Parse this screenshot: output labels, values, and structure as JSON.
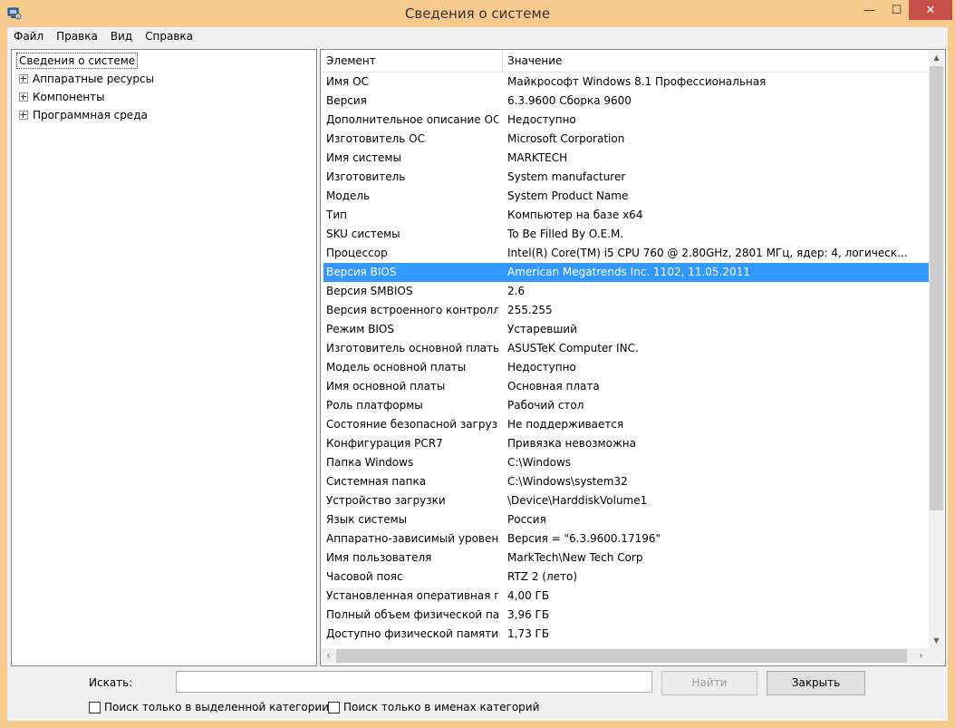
{
  "window": {
    "title": "Сведения о системе",
    "minimize": "—",
    "maximize": "☐",
    "close": "✕"
  },
  "menu": [
    "Файл",
    "Правка",
    "Вид",
    "Справка"
  ],
  "tree": {
    "root": "Сведения о системе",
    "children": [
      "Аппаратные ресурсы",
      "Компоненты",
      "Программная среда"
    ]
  },
  "list": {
    "columns": [
      "Элемент",
      "Значение"
    ],
    "selected_index": 10,
    "rows": [
      {
        "item": "Имя ОС",
        "value": "Майкрософт Windows 8.1 Профессиональная"
      },
      {
        "item": "Версия",
        "value": "6.3.9600 Сборка 9600"
      },
      {
        "item": "Дополнительное описание ОС",
        "value": "Недоступно"
      },
      {
        "item": "Изготовитель ОС",
        "value": "Microsoft Corporation"
      },
      {
        "item": "Имя системы",
        "value": "MARKTECH"
      },
      {
        "item": "Изготовитель",
        "value": "System manufacturer"
      },
      {
        "item": "Модель",
        "value": "System Product Name"
      },
      {
        "item": "Тип",
        "value": "Компьютер на базе x64"
      },
      {
        "item": "SKU системы",
        "value": "To Be Filled By O.E.M."
      },
      {
        "item": "Процессор",
        "value": "Intel(R) Core(TM) i5 CPU        760  @ 2.80GHz, 2801 МГц, ядер: 4, логическ..."
      },
      {
        "item": "Версия BIOS",
        "value": "American Megatrends Inc. 1102, 11.05.2011"
      },
      {
        "item": "Версия SMBIOS",
        "value": "2.6"
      },
      {
        "item": "Версия встроенного контролл...",
        "value": "255.255"
      },
      {
        "item": "Режим BIOS",
        "value": "Устаревший"
      },
      {
        "item": "Изготовитель основной платы",
        "value": "ASUSTeK Computer INC."
      },
      {
        "item": "Модель основной платы",
        "value": "Недоступно"
      },
      {
        "item": "Имя основной платы",
        "value": "Основная плата"
      },
      {
        "item": "Роль платформы",
        "value": "Рабочий стол"
      },
      {
        "item": "Состояние безопасной загруз...",
        "value": "Не поддерживается"
      },
      {
        "item": "Конфигурация PCR7",
        "value": "Привязка невозможна"
      },
      {
        "item": "Папка Windows",
        "value": "C:\\Windows"
      },
      {
        "item": "Системная папка",
        "value": "C:\\Windows\\system32"
      },
      {
        "item": "Устройство загрузки",
        "value": "\\Device\\HarddiskVolume1"
      },
      {
        "item": "Язык системы",
        "value": "Россия"
      },
      {
        "item": "Аппаратно-зависимый уровен...",
        "value": "Версия = \"6.3.9600.17196\""
      },
      {
        "item": "Имя пользователя",
        "value": "MarkTech\\New Tech Corp"
      },
      {
        "item": "Часовой пояс",
        "value": "RTZ 2 (лето)"
      },
      {
        "item": "Установленная оперативная п...",
        "value": "4,00 ГБ"
      },
      {
        "item": "Полный объем физической па...",
        "value": "3,96 ГБ"
      },
      {
        "item": "Доступно физической памяти",
        "value": "1,73 ГБ"
      }
    ]
  },
  "search": {
    "label": "Искать:",
    "value": "",
    "find_button": "Найти",
    "close_button": "Закрыть",
    "check_selected_category": "Поиск только в выделенной категории",
    "check_category_names": "Поиск только в именах категорий"
  },
  "colors": {
    "selection": "#3399ff",
    "title_bar": "#f6c98e",
    "close_button": "#c7504b"
  }
}
